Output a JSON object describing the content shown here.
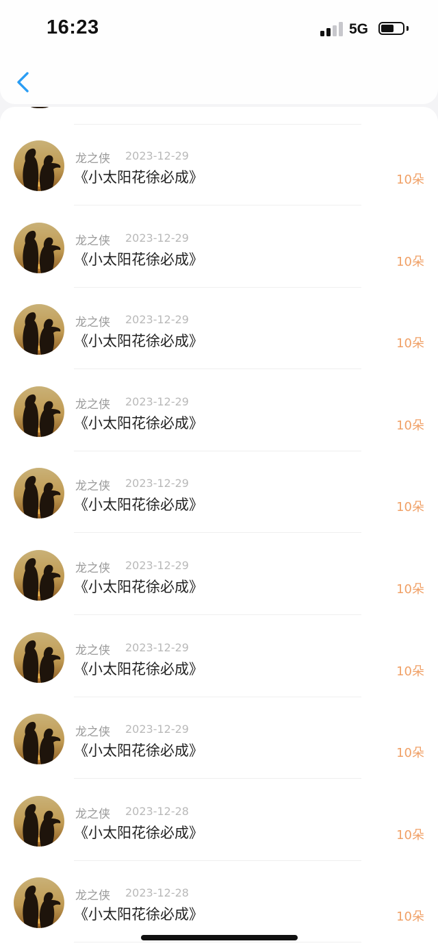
{
  "status_bar": {
    "time": "16:23",
    "network": "5G",
    "signal_bars_active": 2,
    "signal_bars_total": 4,
    "battery_level": 0.6
  },
  "nav": {
    "back_icon": "chevron-left-icon",
    "accent_color": "#2a9df4"
  },
  "records": [
    {
      "name": "龙之侠",
      "date": "2023-12-29",
      "title": "《小太阳花徐必成》",
      "amount": "10朵"
    },
    {
      "name": "龙之侠",
      "date": "2023-12-29",
      "title": "《小太阳花徐必成》",
      "amount": "10朵"
    },
    {
      "name": "龙之侠",
      "date": "2023-12-29",
      "title": "《小太阳花徐必成》",
      "amount": "10朵"
    },
    {
      "name": "龙之侠",
      "date": "2023-12-29",
      "title": "《小太阳花徐必成》",
      "amount": "10朵"
    },
    {
      "name": "龙之侠",
      "date": "2023-12-29",
      "title": "《小太阳花徐必成》",
      "amount": "10朵"
    },
    {
      "name": "龙之侠",
      "date": "2023-12-29",
      "title": "《小太阳花徐必成》",
      "amount": "10朵"
    },
    {
      "name": "龙之侠",
      "date": "2023-12-29",
      "title": "《小太阳花徐必成》",
      "amount": "10朵"
    },
    {
      "name": "龙之侠",
      "date": "2023-12-29",
      "title": "《小太阳花徐必成》",
      "amount": "10朵"
    },
    {
      "name": "龙之侠",
      "date": "2023-12-28",
      "title": "《小太阳花徐必成》",
      "amount": "10朵"
    },
    {
      "name": "龙之侠",
      "date": "2023-12-28",
      "title": "《小太阳花徐必成》",
      "amount": "10朵"
    }
  ],
  "colors": {
    "amount": "#f0a066",
    "name": "#9a9a9a",
    "date": "#b9b9b9",
    "title": "#222222"
  }
}
